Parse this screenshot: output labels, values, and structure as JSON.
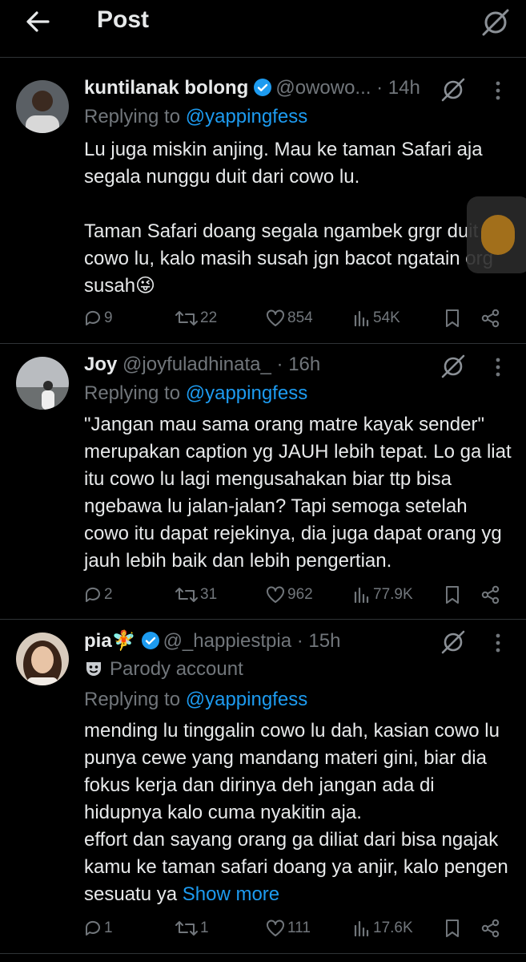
{
  "header": {
    "title": "Post"
  },
  "replies": [
    {
      "display_name": "kuntilanak bolong",
      "verified": true,
      "handle": "@owowo...",
      "time": "· 14h",
      "replying_label": "Replying to",
      "replying_to": "@yappingfess",
      "paragraphs": [
        "Lu juga miskin anjing. Mau ke taman Safari aja segala nunggu duit dari cowo lu.",
        "Taman Safari doang segala ngambek grgr duit cowo lu, kalo masih susah jgn bacot ngatain org susah😜"
      ],
      "stats": {
        "replies": "9",
        "reposts": "22",
        "likes": "854",
        "views": "54K"
      }
    },
    {
      "display_name": "Joy",
      "verified": false,
      "handle": "@joyfuladhinata_",
      "time": "· 16h",
      "replying_label": "Replying to",
      "replying_to": "@yappingfess",
      "paragraphs": [
        "\"Jangan mau sama orang matre kayak sender\" merupakan caption yg JAUH lebih tepat. Lo ga liat itu cowo lu lagi mengusahakan biar ttp bisa ngebawa lu jalan-jalan? Tapi semoga setelah cowo itu dapat rejekinya, dia juga dapat orang yg jauh lebih baik dan lebih pengertian."
      ],
      "stats": {
        "replies": "2",
        "reposts": "31",
        "likes": "962",
        "views": "77.9K"
      }
    },
    {
      "display_name": "pia🧚",
      "verified": true,
      "handle": "@_happiestpia",
      "time": "· 15h",
      "parody_label": "Parody account",
      "replying_label": "Replying to",
      "replying_to": "@yappingfess",
      "paragraphs": [
        "mending lu tinggalin cowo lu dah, kasian cowo lu punya cewe yang mandang materi gini, biar dia fokus kerja dan dirinya deh jangan ada di hidupnya kalo cuma nyakitin aja.\neffort dan sayang orang ga diliat dari bisa ngajak kamu ke taman safari doang ya anjir, kalo pengen sesuatu ya "
      ],
      "show_more": "Show more",
      "stats": {
        "replies": "1",
        "reposts": "1",
        "likes": "111",
        "views": "17.6K"
      }
    }
  ],
  "colors": {
    "accent": "#1d9bf0",
    "muted": "#71767b",
    "text": "#e7e9ea",
    "background": "#000000",
    "divider": "#2f3336"
  }
}
